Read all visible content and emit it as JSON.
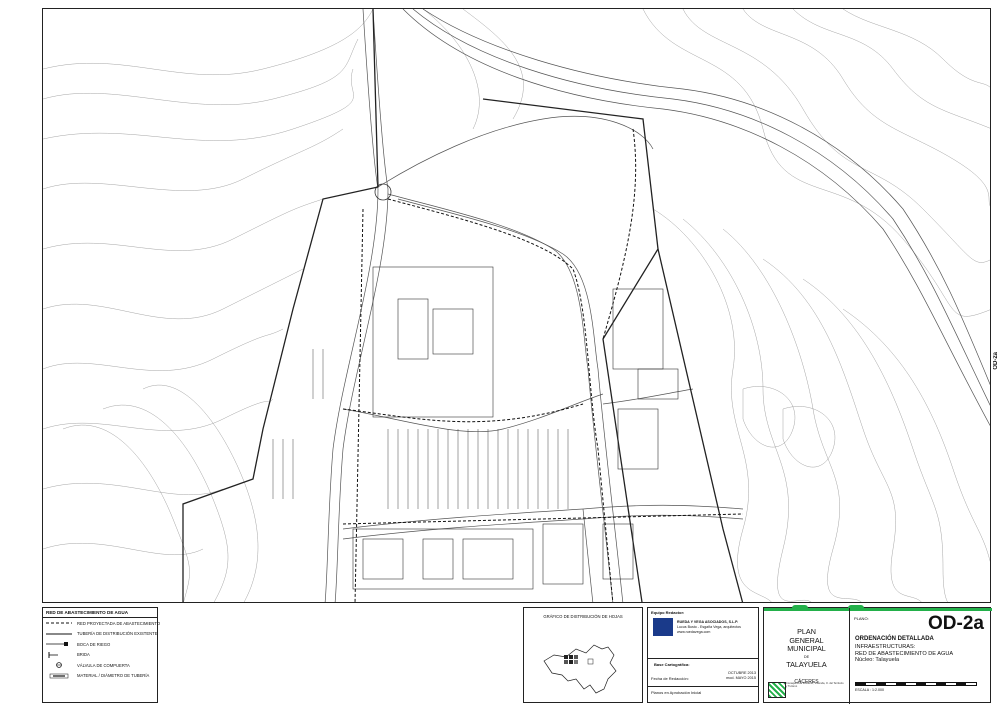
{
  "legend": {
    "title": "RED DE ABASTECIMIENTO DE AGUA",
    "items": [
      {
        "label": "RED PROYECTADA DE ABASTECIMIENTO",
        "symbol": "dashed-line"
      },
      {
        "label": "TUBERÍA DE DISTRIBUCIÓN EXISTENTE",
        "symbol": "solid-line"
      },
      {
        "label": "BOCA DE RIEGO",
        "symbol": "hydrant-mark"
      },
      {
        "label": "BRIDA",
        "symbol": "flange-mark"
      },
      {
        "label": "VÁLVULA DE COMPUERTA",
        "symbol": "valve-circle"
      },
      {
        "label": "MATERIAL / DIÁMETRO DE TUBERÍA",
        "symbol": "pipe-tag"
      }
    ]
  },
  "keymap": {
    "title": "GRÁFICO DE DISTRIBUCIÓN DE HOJAS"
  },
  "info": {
    "equipo_label": "Equipo Redactor:",
    "company_name": "RUEDA Y VEGA ASOCIADOS, S.L.P.",
    "company_line2": "Lucus Busto - Esgaña Vega, arquitectos",
    "company_line3": "www.ruedavega.com",
    "base_label": "Base Cartográfica:",
    "fecha_label": "Fecha de Redacción:",
    "fecha_value1": "OCTUBRE 2013",
    "fecha_value2": "mod. MAYO 2015",
    "planos_label": "Planos en Aprobación Inicial"
  },
  "plan": {
    "line1": "PLAN",
    "line2": "GENERAL",
    "line3": "MUNICIPAL",
    "de": "DE",
    "municipality": "TALAYUELA",
    "province": "CÁCERES",
    "plano_label": "PLANO:",
    "code": "OD-2a",
    "title_bold": "ORDENACIÓN DETALLADA",
    "title_line2": "INFRAESTRUCTURAS:",
    "title_line3": "RED DE ABASTECIMIENTO DE AGUA",
    "title_line4": "Núcleo: Talayuela",
    "scale": "ESCALA : 1:2.000",
    "footer_text": "Consejería de Fomento, Vivienda, O. del Territorio y Turismo"
  },
  "sheet_code": "OD-2a",
  "colors": {
    "accent_green": "#23b04a",
    "logo_blue": "#1a3a8a",
    "line": "#222222"
  }
}
